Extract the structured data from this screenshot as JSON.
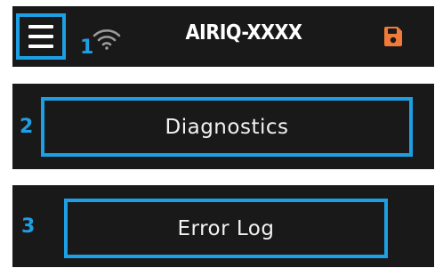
{
  "header": {
    "title": "AIRIQ-XXXX",
    "menu_marker": "1",
    "menu_icon": "hamburger-menu-icon",
    "status_icon": "wifi-icon",
    "action_icon": "save-icon",
    "action_icon_color": "#f07a3a"
  },
  "rows": [
    {
      "marker": "2",
      "label": "Diagnostics"
    },
    {
      "marker": "3",
      "label": "Error Log"
    }
  ],
  "colors": {
    "panel_background": "#191919",
    "highlight": "#1e9fe3",
    "text": "#ffffff"
  }
}
